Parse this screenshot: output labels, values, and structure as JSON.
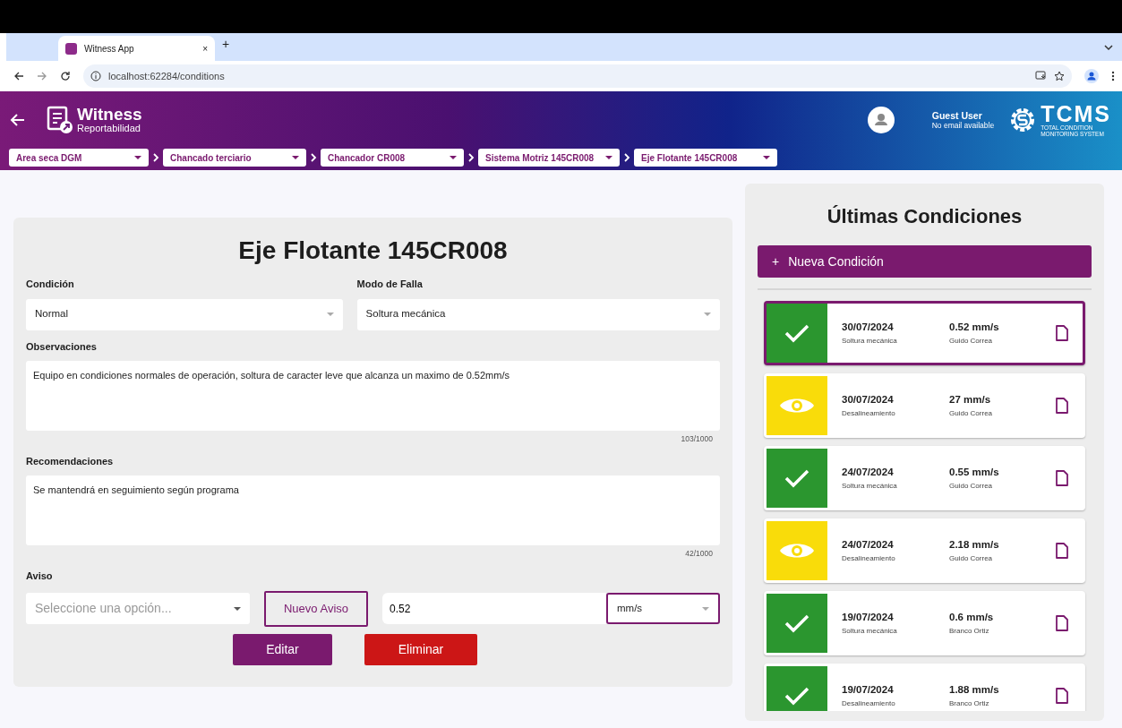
{
  "browser": {
    "tab_title": "Witness App",
    "tab_close": "×",
    "new_tab": "+",
    "url": "localhost:62284/conditions"
  },
  "header": {
    "brand": "Witness",
    "subtitle": "Reportabilidad",
    "user_name": "Guest User",
    "user_email": "No email available",
    "logo_text": "TCMS",
    "logo_line_1": "TOTAL CONDITION",
    "logo_line_2": "MONITORING SYSTEM"
  },
  "breadcrumbs": [
    {
      "label": "Area seca DGM"
    },
    {
      "label": "Chancado terciario"
    },
    {
      "label": "Chancador CR008"
    },
    {
      "label": "Sistema Motriz 145CR008"
    },
    {
      "label": "Eje Flotante 145CR008"
    }
  ],
  "form": {
    "title": "Eje Flotante 145CR008",
    "condition": {
      "label": "Condición",
      "value": "Normal"
    },
    "failure_mode": {
      "label": "Modo de Falla",
      "value": "Soltura mecánica"
    },
    "observations": {
      "label": "Observaciones",
      "value": "Equipo en condiciones normales de operación, soltura de caracter leve que alcanza un maximo de 0.52mm/s",
      "counter": "103/1000"
    },
    "recommendations": {
      "label": "Recomendaciones",
      "value": "Se mantendrá en seguimiento según programa",
      "counter": "42/1000"
    },
    "notice": {
      "label": "Aviso",
      "placeholder": "Seleccione una opción...",
      "new_button": "Nuevo Aviso",
      "amount": "0.52",
      "unit": "mm/s"
    },
    "edit_button": "Editar",
    "delete_button": "Eliminar"
  },
  "latest": {
    "title": "Últimas Condiciones",
    "new_button_icon": "+",
    "new_button": "Nueva Condición",
    "items": [
      {
        "kind": "ok",
        "selected": true,
        "date": "30/07/2024",
        "mode": "Soltura mecánica",
        "value": "0.52 mm/s",
        "person": "Guido Correa"
      },
      {
        "kind": "watch",
        "selected": false,
        "date": "30/07/2024",
        "mode": "Desalineamiento",
        "value": "27 mm/s",
        "person": "Guido Correa"
      },
      {
        "kind": "ok",
        "selected": false,
        "date": "24/07/2024",
        "mode": "Soltura mecánica",
        "value": "0.55 mm/s",
        "person": "Guido Correa"
      },
      {
        "kind": "watch",
        "selected": false,
        "date": "24/07/2024",
        "mode": "Desalineamiento",
        "value": "2.18 mm/s",
        "person": "Guido Correa"
      },
      {
        "kind": "ok",
        "selected": false,
        "date": "19/07/2024",
        "mode": "Soltura mecánica",
        "value": "0.6 mm/s",
        "person": "Branco Ortiz"
      },
      {
        "kind": "ok",
        "selected": false,
        "date": "19/07/2024",
        "mode": "Desalineamiento",
        "value": "1.88 mm/s",
        "person": "Branco Ortiz"
      }
    ]
  }
}
